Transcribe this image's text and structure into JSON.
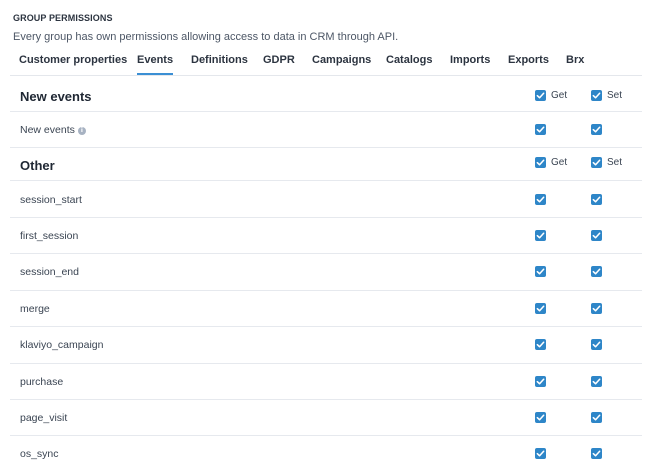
{
  "header": {
    "title": "GROUP PERMISSIONS",
    "description": "Every group has own permissions allowing access to data in CRM through API."
  },
  "tabs": [
    {
      "label": "Customer properties",
      "active": false
    },
    {
      "label": "Events",
      "active": true
    },
    {
      "label": "Definitions",
      "active": false
    },
    {
      "label": "GDPR",
      "active": false
    },
    {
      "label": "Campaigns",
      "active": false
    },
    {
      "label": "Catalogs",
      "active": false
    },
    {
      "label": "Imports",
      "active": false
    },
    {
      "label": "Exports",
      "active": false
    },
    {
      "label": "Brx",
      "active": false
    }
  ],
  "columns": {
    "get_label": "Get",
    "set_label": "Set"
  },
  "groups": [
    {
      "title": "New events",
      "get_checked": true,
      "set_checked": true,
      "rows": [
        {
          "label": "New events",
          "has_info_icon": true,
          "get": true,
          "set": true
        }
      ]
    },
    {
      "title": "Other",
      "get_checked": true,
      "set_checked": true,
      "rows": [
        {
          "label": "session_start",
          "get": true,
          "set": true
        },
        {
          "label": "first_session",
          "get": true,
          "set": true
        },
        {
          "label": "session_end",
          "get": true,
          "set": true
        },
        {
          "label": "merge",
          "get": true,
          "set": true
        },
        {
          "label": "klaviyo_campaign",
          "get": true,
          "set": true
        },
        {
          "label": "purchase",
          "get": true,
          "set": true
        },
        {
          "label": "page_visit",
          "get": true,
          "set": true
        },
        {
          "label": "os_sync",
          "get": true,
          "set": true
        }
      ]
    }
  ],
  "colors": {
    "checkbox": "#2e86c8",
    "active_tab_underline": "#3b8fd4",
    "divider": "#e6e9ee"
  },
  "icons": {
    "info": "info-icon",
    "check": "check-icon"
  }
}
